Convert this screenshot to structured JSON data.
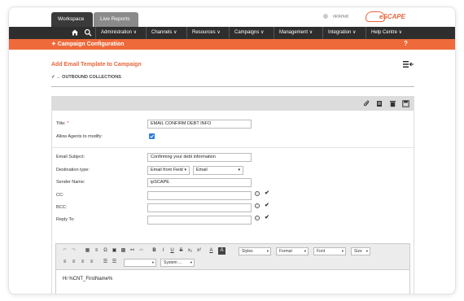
{
  "top_tabs": [
    "Workspace",
    "Live Reports"
  ],
  "user": {
    "name": "nickmat"
  },
  "logo": {
    "text": "eSCAPE"
  },
  "nav": {
    "items": [
      "Administration ∨",
      "Channels ∨",
      "Resources ∨",
      "Campaigns ∨",
      "Management ∨",
      "Integration ∨",
      "Help Centre ∨"
    ]
  },
  "config_bar": {
    "title": "✦ Campaign Configuration",
    "help": "?"
  },
  "page": {
    "heading": "Add Email Template to Campaign",
    "breadcrumb": "✓ → OUTBOUND COLLECTIONS"
  },
  "form": {
    "title_label": "Title:",
    "title_required": "*",
    "title_value": "EMAIL CONFIRM DEBT INFO",
    "agents_label": "Allow Agents to modify:",
    "subject_label": "Email Subject:",
    "subject_value": "Confirming your debt information",
    "destination_label": "Destination type:",
    "destination_value": "Email from Field",
    "destination_field": "Email",
    "sender_label": "Sender Name:",
    "sender_value": "ipSCAPE",
    "cc_label": "CC:",
    "bcc_label": "BCC:",
    "reply_label": "Reply To:",
    "info_glyph": "i",
    "tick_glyph": "✔"
  },
  "editor": {
    "row1": {
      "undo": "↶",
      "redo": "↷",
      "table": "▦",
      "hr": "≡",
      "omega": "Ω",
      "image": "▣",
      "media": "▩",
      "link": "⚯",
      "unlink": "⚮",
      "bold": "B",
      "italic": "I",
      "underline": "U",
      "strike": "S",
      "sub": "x₂",
      "sup": "x²",
      "font_color": "A",
      "bg_color": "A"
    },
    "styles": "Styles",
    "format": "Format",
    "font": "Font",
    "size": "Size",
    "row2": {
      "left": "≡",
      "center": "≡",
      "right": "≡",
      "justify": "≡",
      "ol": "☰",
      "ul": "☰"
    },
    "blank_drop": "",
    "system_drop": "System ...",
    "body": "Hi %CNT_FirstName%"
  }
}
